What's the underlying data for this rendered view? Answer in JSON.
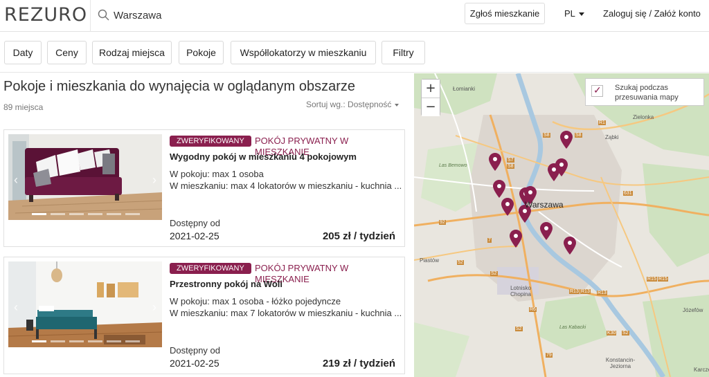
{
  "header": {
    "logo": "REZURO",
    "search_value": "Warszawa",
    "report_button": "Zgłoś mieszkanie",
    "lang": "PL",
    "login": "Zaloguj się / Załóż konto"
  },
  "filters": [
    "Daty",
    "Ceny",
    "Rodzaj miejsca",
    "Pokoje",
    "Współlokatorzy w mieszkaniu",
    "Filtry"
  ],
  "list": {
    "title": "Pokoje i mieszkania do wynajęcia w oglądanym obszarze",
    "count": "89 miejsca",
    "sort": "Sortuj wg.: Dostępność"
  },
  "listings": [
    {
      "badge": "ZWERYFIKOWANY",
      "type": "POKÓJ PRYWATNY W MIESZKANIE",
      "title": "Wygodny pokój w mieszkaniu 4 pokojowym",
      "room_info": "W pokoju: max 1 osoba",
      "flat_info": "W mieszkaniu: max 4 lokatorów w mieszkaniu - kuchnia ...",
      "available_label": "Dostępny od",
      "available_date": "2021-02-25",
      "price": "205 zł / tydzień"
    },
    {
      "badge": "ZWERYFIKOWANY",
      "type": "POKÓJ PRYWATNY W MIESZKANIE",
      "title": "Przestronny pokój na Woli",
      "room_info": "W pokoju: max 1 osoba - łóżko pojedyncze",
      "flat_info": "W mieszkaniu: max 7 lokatorów w mieszkaniu - kuchnia ...",
      "available_label": "Dostępny od",
      "available_date": "2021-02-25",
      "price": "219 zł / tydzień"
    }
  ],
  "map": {
    "zoom_in": "+",
    "zoom_out": "−",
    "search_on_move_label": "Szukaj podczas przesuwania mapy",
    "city_label": "Warszawa",
    "places": [
      "Łomianki",
      "Zielonka",
      "Ząbki",
      "Józefów",
      "Piastów",
      "Lotnisko Chopina",
      "Konstancin-Jeziorna",
      "Las Bemowo",
      "Las Kabacki",
      "Karcze"
    ],
    "roads": [
      "S8",
      "S8",
      "S7",
      "S8",
      "92",
      "7",
      "52",
      "S2",
      "R13",
      "R13",
      "R13",
      "631",
      "R15",
      "R15",
      "S2",
      "79",
      "R1",
      "S2",
      "K30",
      "R6"
    ]
  },
  "colors": {
    "accent": "#8a1f4e"
  }
}
